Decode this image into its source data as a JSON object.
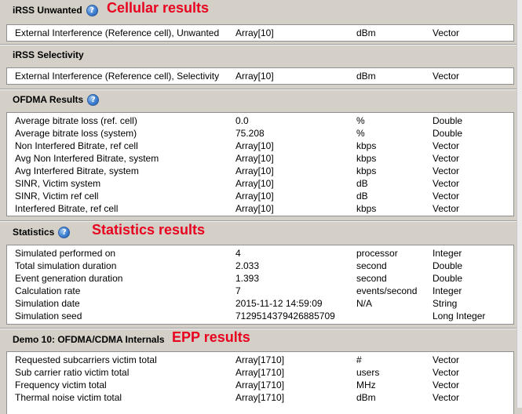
{
  "sections": {
    "irss_unwanted": {
      "title": "iRSS Unwanted",
      "annotation": "Cellular results",
      "rows": [
        {
          "name": "External Interference (Reference cell), Unwanted",
          "value": "Array[10]",
          "unit": "dBm",
          "type": "Vector"
        }
      ]
    },
    "irss_selectivity": {
      "title": "iRSS Selectivity",
      "rows": [
        {
          "name": "External Interference (Reference cell), Selectivity",
          "value": "Array[10]",
          "unit": "dBm",
          "type": "Vector"
        }
      ]
    },
    "ofdma": {
      "title": "OFDMA Results",
      "rows": [
        {
          "name": "Average bitrate loss (ref. cell)",
          "value": "0.0",
          "unit": "%",
          "type": "Double"
        },
        {
          "name": "Average bitrate loss (system)",
          "value": "75.208",
          "unit": "%",
          "type": "Double"
        },
        {
          "name": "Non Interfered Bitrate, ref cell",
          "value": "Array[10]",
          "unit": "kbps",
          "type": "Vector"
        },
        {
          "name": "Avg Non Interfered Bitrate, system",
          "value": "Array[10]",
          "unit": "kbps",
          "type": "Vector"
        },
        {
          "name": "Avg Interfered Bitrate, system",
          "value": "Array[10]",
          "unit": "kbps",
          "type": "Vector"
        },
        {
          "name": "SINR, Victim system",
          "value": "Array[10]",
          "unit": "dB",
          "type": "Vector"
        },
        {
          "name": "SINR, Victim ref cell",
          "value": "Array[10]",
          "unit": "dB",
          "type": "Vector"
        },
        {
          "name": "Interfered Bitrate, ref cell",
          "value": "Array[10]",
          "unit": "kbps",
          "type": "Vector"
        }
      ]
    },
    "statistics": {
      "title": "Statistics",
      "annotation": "Statistics results",
      "rows": [
        {
          "name": "Simulated performed on",
          "value": "4",
          "unit": "processor",
          "type": "Integer"
        },
        {
          "name": "Total simulation duration",
          "value": "2.033",
          "unit": "second",
          "type": "Double"
        },
        {
          "name": "Event generation duration",
          "value": "1.393",
          "unit": "second",
          "type": "Double"
        },
        {
          "name": "Calculation rate",
          "value": "7",
          "unit": "events/second",
          "type": "Integer"
        },
        {
          "name": "Simulation date",
          "value": "2015-11-12 14:59:09",
          "unit": "N/A",
          "type": "String"
        },
        {
          "name": "Simulation seed",
          "value": "7129514379426885709",
          "unit": "",
          "type": "Long Integer"
        }
      ]
    },
    "demo10": {
      "title": "Demo 10: OFDMA/CDMA Internals",
      "annotation": "EPP results",
      "rows": [
        {
          "name": "Requested subcarriers victim total",
          "value": "Array[1710]",
          "unit": "#",
          "type": "Vector"
        },
        {
          "name": "Sub carrier ratio victim total",
          "value": "Array[1710]",
          "unit": "users",
          "type": "Vector"
        },
        {
          "name": "Frequency victim total",
          "value": "Array[1710]",
          "unit": "MHz",
          "type": "Vector"
        },
        {
          "name": "Thermal noise victim total",
          "value": "Array[1710]",
          "unit": "dBm",
          "type": "Vector"
        }
      ]
    }
  },
  "icons": {
    "help": "?"
  },
  "colors": {
    "annotation": "#e8001e",
    "panel_background": "#ffffff",
    "window_background": "#d4d0c8"
  }
}
